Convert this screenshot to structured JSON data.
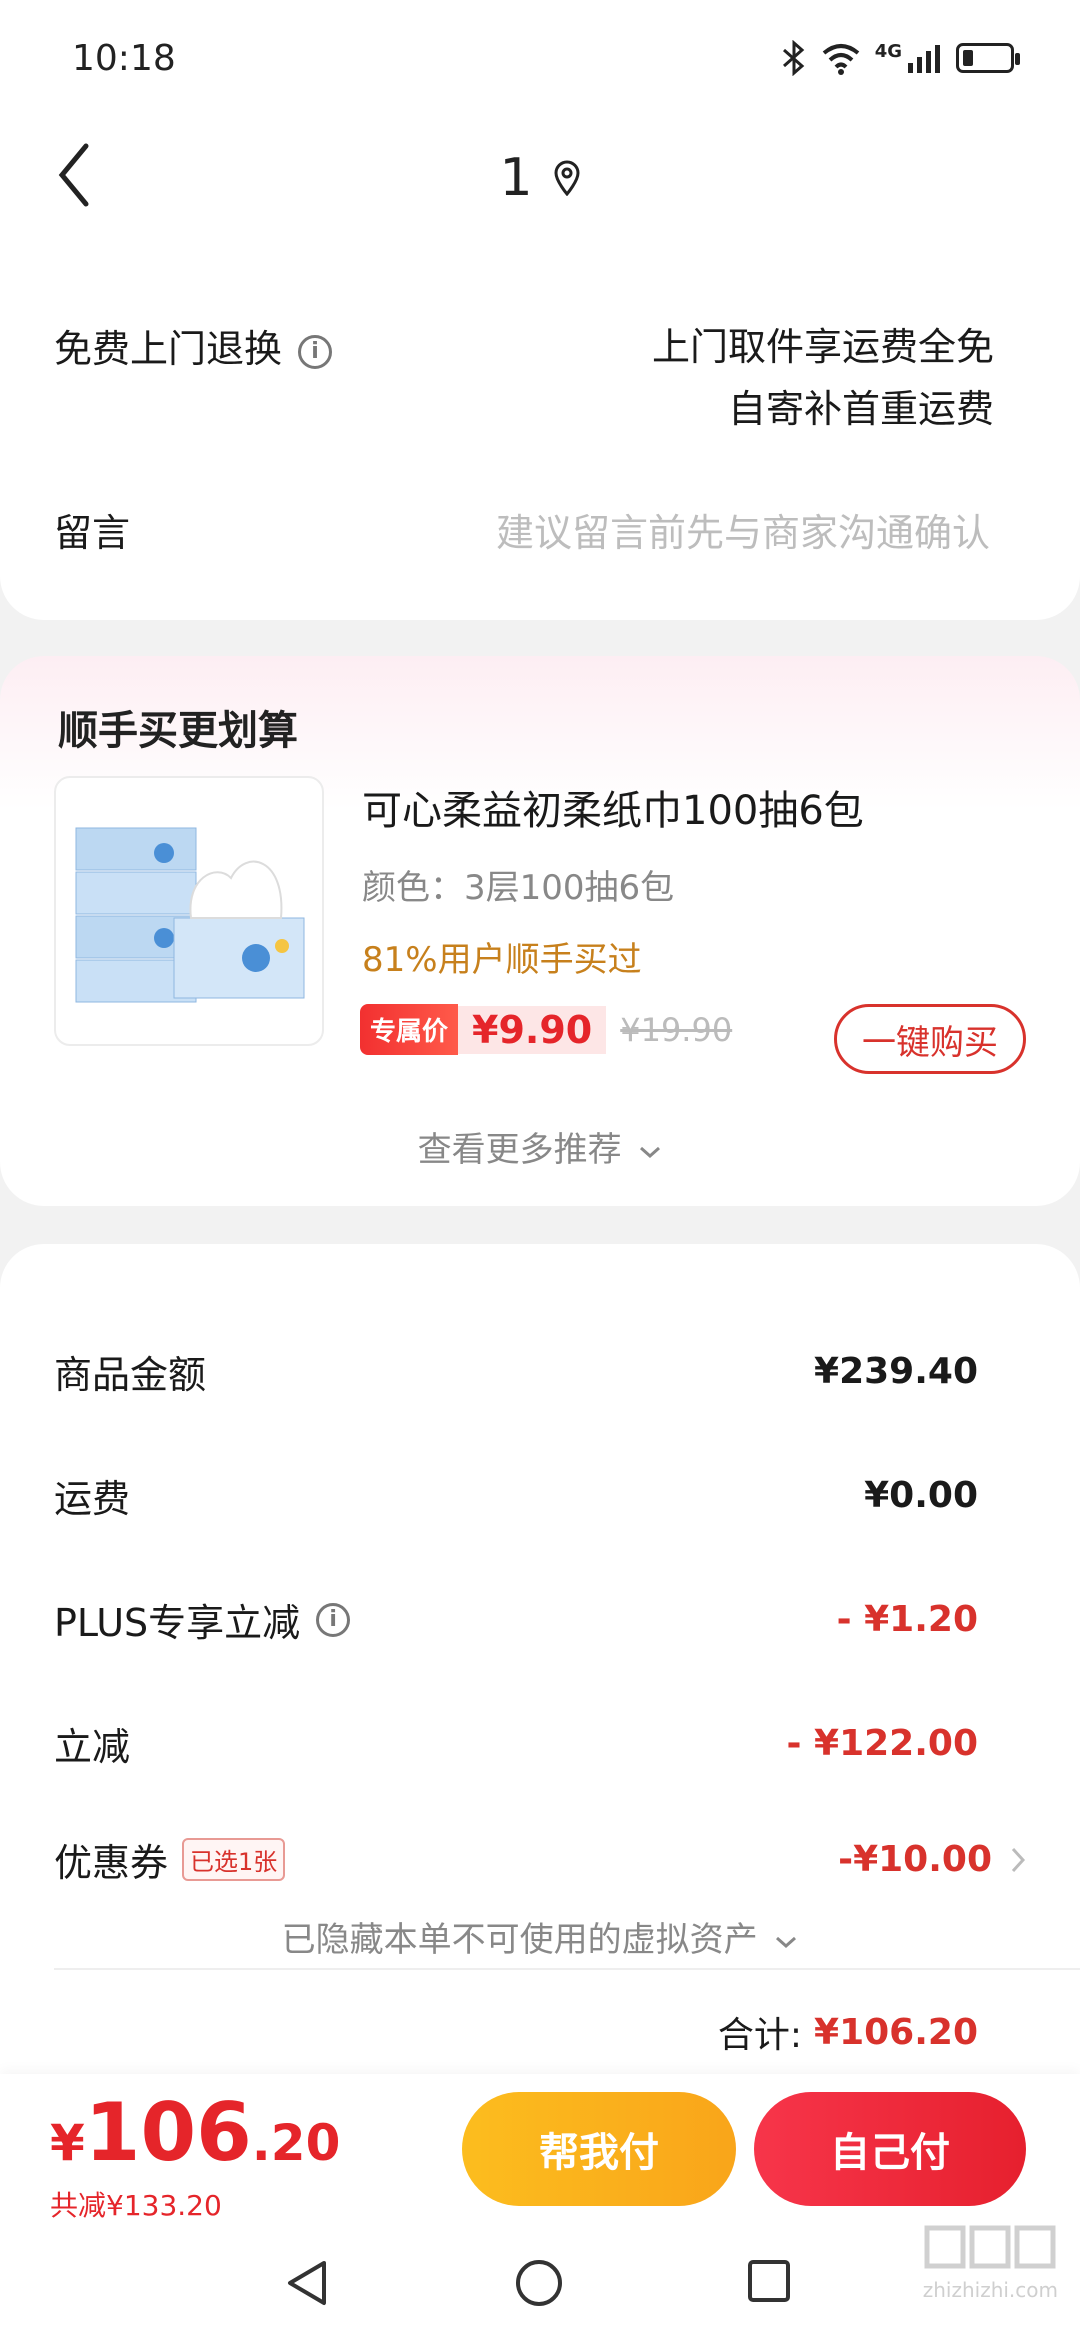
{
  "status_bar": {
    "time": "10:18",
    "network": "4G"
  },
  "header": {
    "title": "1"
  },
  "service": {
    "return_label": "免费上门退换",
    "return_desc_line1": "上门取件享运费全免",
    "return_desc_line2": "自寄补首重运费",
    "message_label": "留言",
    "message_placeholder": "建议留言前先与商家沟通确认"
  },
  "recommend": {
    "title": "顺手买更划算",
    "product_name": "可心柔益初柔纸巾100抽6包",
    "spec": "颜色：3层100抽6包",
    "social_proof": "81%用户顺手买过",
    "tag": "专属价",
    "price": "¥9.90",
    "original_price": "¥19.90",
    "buy_button": "一键购买",
    "more": "查看更多推荐"
  },
  "amounts": {
    "goods_label": "商品金额",
    "goods_value": "¥239.40",
    "shipping_label": "运费",
    "shipping_value": "¥0.00",
    "plus_label": "PLUS专享立减",
    "plus_value": "- ¥1.20",
    "discount_label": "立减",
    "discount_value": "- ¥122.00",
    "coupon_label": "优惠券",
    "coupon_badge": "已选1张",
    "coupon_value": "-¥10.00",
    "hidden_assets": "已隐藏本单不可使用的虚拟资产",
    "total_label": "合计:",
    "total_value": "¥106.20"
  },
  "bottom_bar": {
    "currency": "¥",
    "amount_int": "106",
    "amount_dec": ".20",
    "saved": "共减¥133.20",
    "help_pay": "帮我付",
    "self_pay": "自己付"
  },
  "watermark": {
    "text": "zhizhizhi.com"
  }
}
